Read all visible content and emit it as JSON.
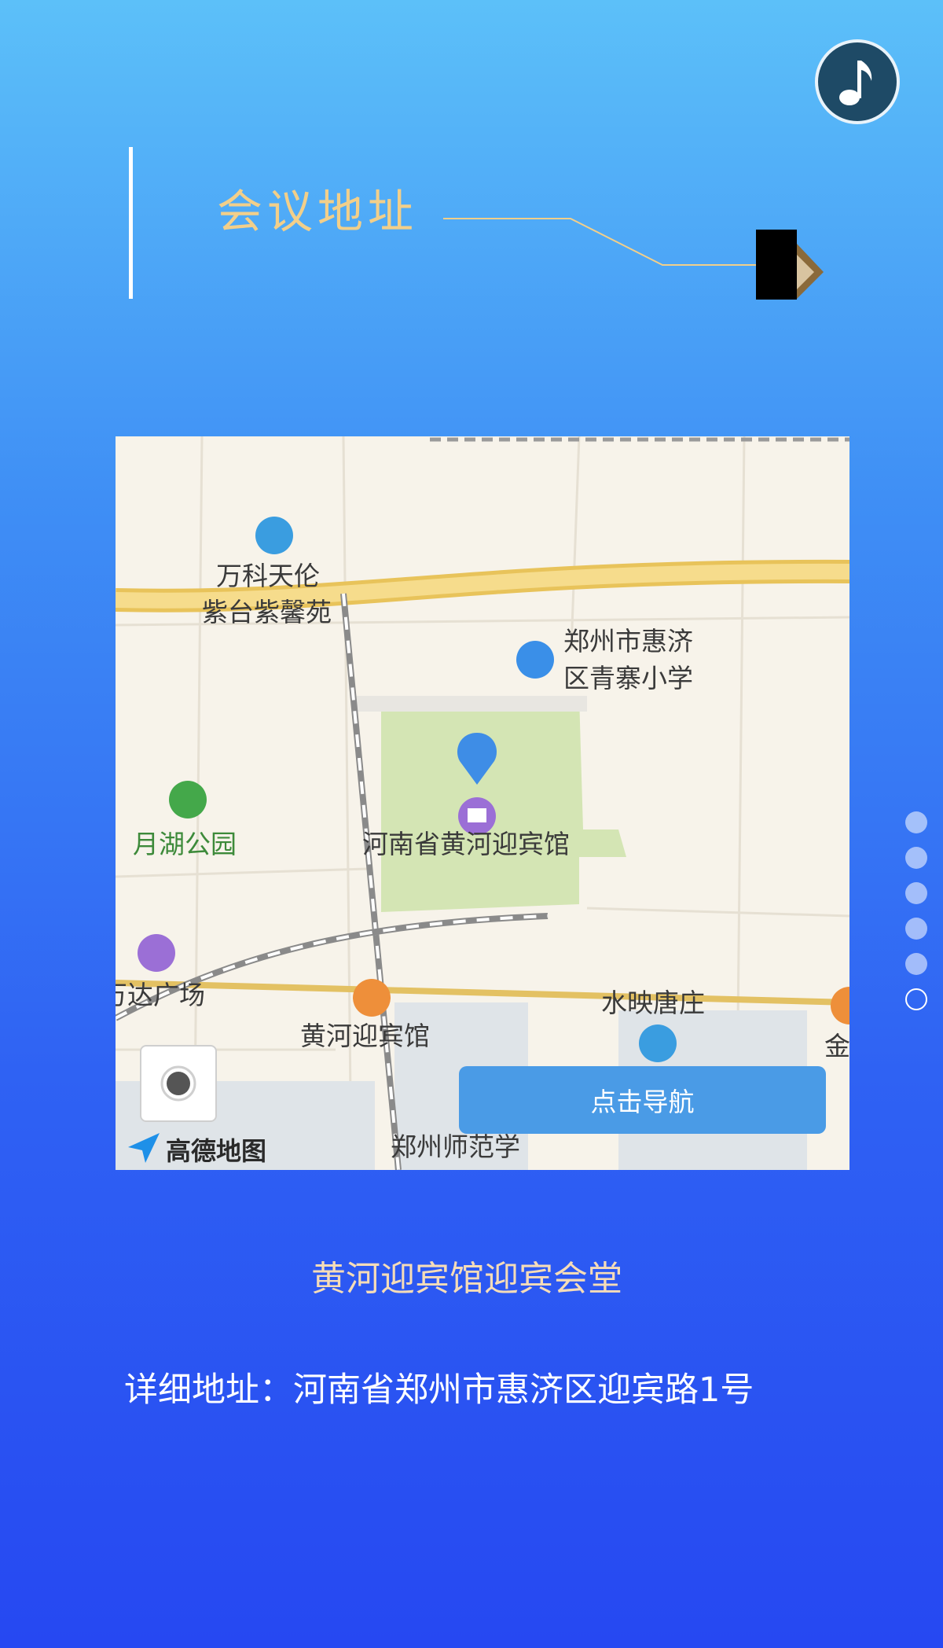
{
  "music_button": {
    "icon": "music-note-icon"
  },
  "header": {
    "title": "会议地址"
  },
  "map": {
    "labels": {
      "wanke": "万科天伦",
      "zitai": "紫台紫馨苑",
      "school_line1": "郑州市惠济",
      "school_line2": "区青寨小学",
      "park": "月湖公园",
      "hotel_main": "河南省黄河迎宾馆",
      "wanda": "万达广场",
      "shuiying": "水映唐庄",
      "hotel_station": "黄河迎宾馆",
      "normal_univ": "郑州师范学",
      "jin": "金"
    },
    "logo": "高德地图",
    "navigate_button": "点击导航",
    "locate_icon": "locate-icon"
  },
  "venue_name": "黄河迎宾馆迎宾会堂",
  "address": "详细地址：河南省郑州市惠济区迎宾路1号",
  "pager": {
    "count": 6,
    "active_index": 5
  }
}
